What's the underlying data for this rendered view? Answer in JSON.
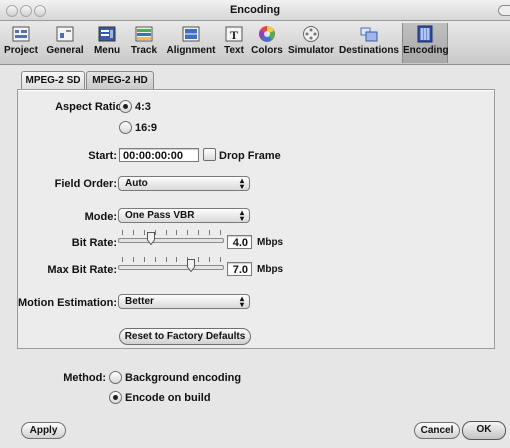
{
  "window": {
    "title": "Encoding"
  },
  "toolbar": {
    "items": [
      {
        "label": "Project"
      },
      {
        "label": "General"
      },
      {
        "label": "Menu"
      },
      {
        "label": "Track"
      },
      {
        "label": "Alignment"
      },
      {
        "label": "Text"
      },
      {
        "label": "Colors"
      },
      {
        "label": "Simulator"
      },
      {
        "label": "Destinations"
      },
      {
        "label": "Encoding"
      }
    ],
    "selected": "Encoding"
  },
  "tabs": [
    {
      "label": "MPEG-2 SD"
    },
    {
      "label": "MPEG-2 HD"
    }
  ],
  "form": {
    "aspect_ratio": {
      "label": "Aspect Ratio:",
      "options": [
        "4:3",
        "16:9"
      ],
      "selected": "4:3"
    },
    "start": {
      "label": "Start:",
      "value": "00:00:00:00",
      "drop_frame_label": "Drop Frame",
      "drop_frame_checked": false
    },
    "field_order": {
      "label": "Field Order:",
      "value": "Auto"
    },
    "mode": {
      "label": "Mode:",
      "value": "One Pass VBR"
    },
    "bit_rate": {
      "label": "Bit Rate:",
      "value": "4.0",
      "unit": "Mbps",
      "level": 0.3
    },
    "max_bit_rate": {
      "label": "Max Bit Rate:",
      "value": "7.0",
      "unit": "Mbps",
      "level": 0.7
    },
    "motion_estimation": {
      "label": "Motion Estimation:",
      "value": "Better"
    },
    "reset_button": "Reset to Factory Defaults"
  },
  "method": {
    "label": "Method:",
    "options": [
      "Background encoding",
      "Encode on build"
    ],
    "selected": "Encode on build"
  },
  "buttons": {
    "apply": "Apply",
    "cancel": "Cancel",
    "ok": "OK"
  }
}
